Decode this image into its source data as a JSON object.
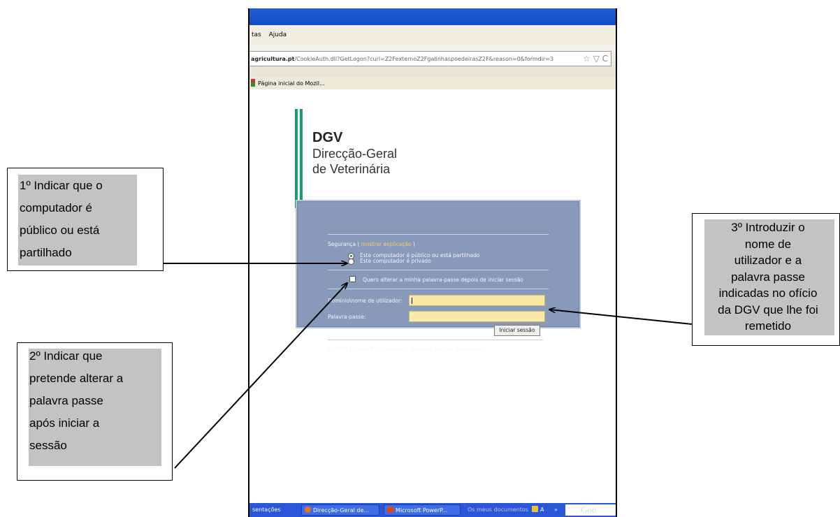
{
  "browser": {
    "menu": [
      "tas",
      "Ajuda"
    ],
    "url_bold": "agricultura.pt",
    "url_rest": "/CookieAuth.dll?GetLogon?curl=Z2FexternoZ2FgalinhaspoedeirasZ2F&reason=0&formdir=3",
    "url_icons": "☆ ▽ C",
    "bookmark": "Página inicial do Mozil..."
  },
  "logo": {
    "acronym": "DGV",
    "line1": "Direcção-Geral",
    "line2": "de Veterinária"
  },
  "login": {
    "security_label": "Segurança (",
    "security_link": "mostrar explicação",
    "security_close": ")",
    "radio_public": "Este computador é público ou está partilhado",
    "radio_private": "Este computador é privado",
    "checkbox_label": "Quero alterar a minha palavra-passe depois de iniciar sessão",
    "username_label": "Domínio\\nome de utilizador:",
    "password_label": "Palavra-passe:",
    "submit": "Iniciar sessão",
    "copyright": "© 2006 Microsoft Corporation. Todos os direitos reservados."
  },
  "taskbar": {
    "items": [
      "sentações",
      "Direcção-Geral de...",
      "Microsoft PowerP...",
      "Os meus documentos",
      "A",
      "»"
    ],
    "search_text": "Goo"
  },
  "annotations": {
    "note1": [
      "1º Indicar que o",
      "computador é",
      "público ou está",
      "partilhado"
    ],
    "note2": [
      "2º Indicar que",
      "pretende alterar a",
      "palavra passe",
      "após iniciar a",
      "sessão"
    ],
    "note3": [
      "3º Introduzir o",
      "nome de",
      "utilizador e a",
      "palavra passe",
      "indicadas no ofício",
      "da DGV que lhe foi",
      "remetido"
    ]
  }
}
